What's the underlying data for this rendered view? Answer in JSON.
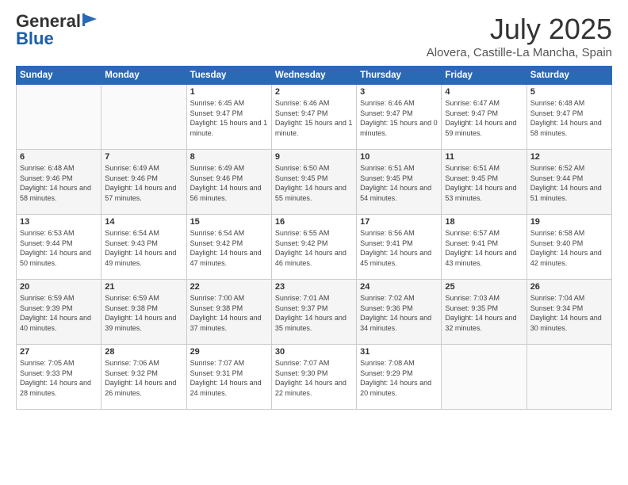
{
  "logo": {
    "general": "General",
    "blue": "Blue"
  },
  "title": "July 2025",
  "location": "Alovera, Castille-La Mancha, Spain",
  "days_of_week": [
    "Sunday",
    "Monday",
    "Tuesday",
    "Wednesday",
    "Thursday",
    "Friday",
    "Saturday"
  ],
  "weeks": [
    [
      {
        "day": "",
        "info": ""
      },
      {
        "day": "",
        "info": ""
      },
      {
        "day": "1",
        "info": "Sunrise: 6:45 AM\nSunset: 9:47 PM\nDaylight: 15 hours and 1 minute."
      },
      {
        "day": "2",
        "info": "Sunrise: 6:46 AM\nSunset: 9:47 PM\nDaylight: 15 hours and 1 minute."
      },
      {
        "day": "3",
        "info": "Sunrise: 6:46 AM\nSunset: 9:47 PM\nDaylight: 15 hours and 0 minutes."
      },
      {
        "day": "4",
        "info": "Sunrise: 6:47 AM\nSunset: 9:47 PM\nDaylight: 14 hours and 59 minutes."
      },
      {
        "day": "5",
        "info": "Sunrise: 6:48 AM\nSunset: 9:47 PM\nDaylight: 14 hours and 58 minutes."
      }
    ],
    [
      {
        "day": "6",
        "info": "Sunrise: 6:48 AM\nSunset: 9:46 PM\nDaylight: 14 hours and 58 minutes."
      },
      {
        "day": "7",
        "info": "Sunrise: 6:49 AM\nSunset: 9:46 PM\nDaylight: 14 hours and 57 minutes."
      },
      {
        "day": "8",
        "info": "Sunrise: 6:49 AM\nSunset: 9:46 PM\nDaylight: 14 hours and 56 minutes."
      },
      {
        "day": "9",
        "info": "Sunrise: 6:50 AM\nSunset: 9:45 PM\nDaylight: 14 hours and 55 minutes."
      },
      {
        "day": "10",
        "info": "Sunrise: 6:51 AM\nSunset: 9:45 PM\nDaylight: 14 hours and 54 minutes."
      },
      {
        "day": "11",
        "info": "Sunrise: 6:51 AM\nSunset: 9:45 PM\nDaylight: 14 hours and 53 minutes."
      },
      {
        "day": "12",
        "info": "Sunrise: 6:52 AM\nSunset: 9:44 PM\nDaylight: 14 hours and 51 minutes."
      }
    ],
    [
      {
        "day": "13",
        "info": "Sunrise: 6:53 AM\nSunset: 9:44 PM\nDaylight: 14 hours and 50 minutes."
      },
      {
        "day": "14",
        "info": "Sunrise: 6:54 AM\nSunset: 9:43 PM\nDaylight: 14 hours and 49 minutes."
      },
      {
        "day": "15",
        "info": "Sunrise: 6:54 AM\nSunset: 9:42 PM\nDaylight: 14 hours and 47 minutes."
      },
      {
        "day": "16",
        "info": "Sunrise: 6:55 AM\nSunset: 9:42 PM\nDaylight: 14 hours and 46 minutes."
      },
      {
        "day": "17",
        "info": "Sunrise: 6:56 AM\nSunset: 9:41 PM\nDaylight: 14 hours and 45 minutes."
      },
      {
        "day": "18",
        "info": "Sunrise: 6:57 AM\nSunset: 9:41 PM\nDaylight: 14 hours and 43 minutes."
      },
      {
        "day": "19",
        "info": "Sunrise: 6:58 AM\nSunset: 9:40 PM\nDaylight: 14 hours and 42 minutes."
      }
    ],
    [
      {
        "day": "20",
        "info": "Sunrise: 6:59 AM\nSunset: 9:39 PM\nDaylight: 14 hours and 40 minutes."
      },
      {
        "day": "21",
        "info": "Sunrise: 6:59 AM\nSunset: 9:38 PM\nDaylight: 14 hours and 39 minutes."
      },
      {
        "day": "22",
        "info": "Sunrise: 7:00 AM\nSunset: 9:38 PM\nDaylight: 14 hours and 37 minutes."
      },
      {
        "day": "23",
        "info": "Sunrise: 7:01 AM\nSunset: 9:37 PM\nDaylight: 14 hours and 35 minutes."
      },
      {
        "day": "24",
        "info": "Sunrise: 7:02 AM\nSunset: 9:36 PM\nDaylight: 14 hours and 34 minutes."
      },
      {
        "day": "25",
        "info": "Sunrise: 7:03 AM\nSunset: 9:35 PM\nDaylight: 14 hours and 32 minutes."
      },
      {
        "day": "26",
        "info": "Sunrise: 7:04 AM\nSunset: 9:34 PM\nDaylight: 14 hours and 30 minutes."
      }
    ],
    [
      {
        "day": "27",
        "info": "Sunrise: 7:05 AM\nSunset: 9:33 PM\nDaylight: 14 hours and 28 minutes."
      },
      {
        "day": "28",
        "info": "Sunrise: 7:06 AM\nSunset: 9:32 PM\nDaylight: 14 hours and 26 minutes."
      },
      {
        "day": "29",
        "info": "Sunrise: 7:07 AM\nSunset: 9:31 PM\nDaylight: 14 hours and 24 minutes."
      },
      {
        "day": "30",
        "info": "Sunrise: 7:07 AM\nSunset: 9:30 PM\nDaylight: 14 hours and 22 minutes."
      },
      {
        "day": "31",
        "info": "Sunrise: 7:08 AM\nSunset: 9:29 PM\nDaylight: 14 hours and 20 minutes."
      },
      {
        "day": "",
        "info": ""
      },
      {
        "day": "",
        "info": ""
      }
    ]
  ]
}
